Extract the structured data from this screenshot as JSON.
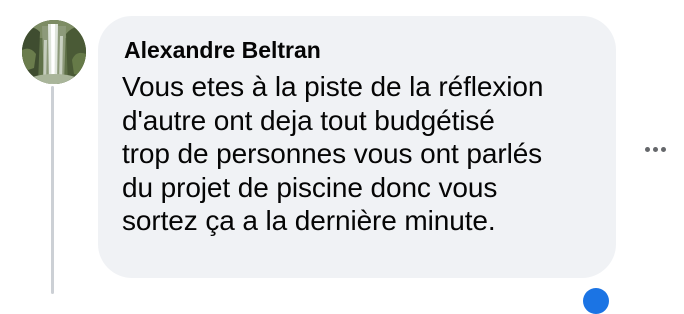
{
  "comment": {
    "author": "Alexandre Beltran",
    "text": "Vous etes à la piste de la réflexion\nd'autre ont deja tout budgétisé\ntrop de personnes vous ont parlés\ndu projet de piscine donc vous\nsortez ça a la dernière minute.",
    "avatar_icon": "waterfall-profile-photo",
    "more_icon": "more-options-icon",
    "reaction_icon": "like-reaction-icon"
  },
  "colors": {
    "bubble_background": "#f0f2f5",
    "text": "#050505",
    "thread_line": "#ccd0d5",
    "more_dots": "#65676b",
    "reaction_blue": "#1b74e4"
  }
}
